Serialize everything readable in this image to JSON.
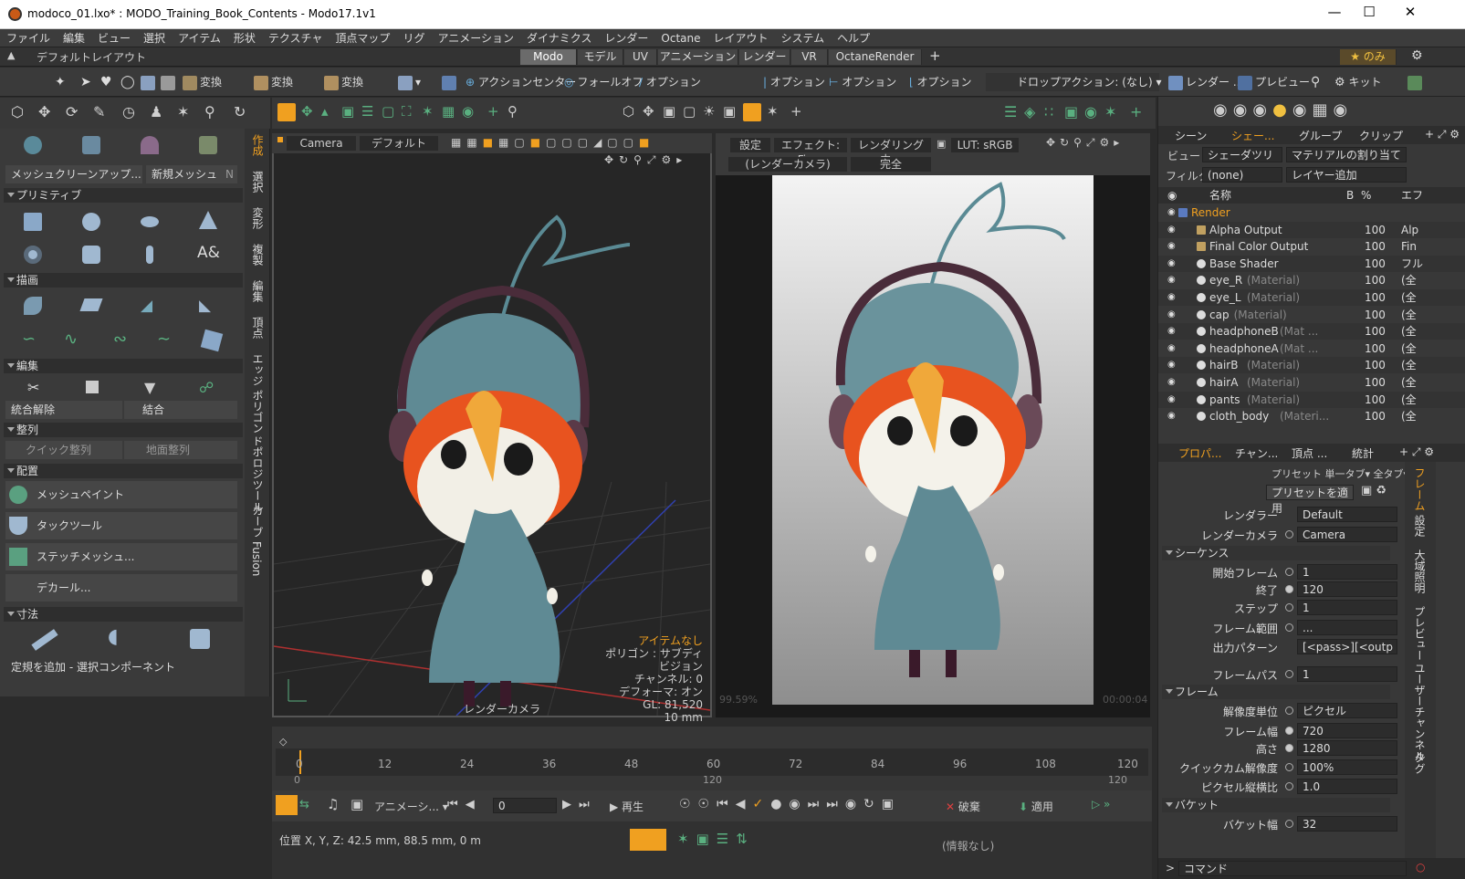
{
  "window": {
    "title": "modoco_01.lxo* : MODO_Training_Book_Contents - Modo17.1v1"
  },
  "menu": [
    "ファイル",
    "編集",
    "ビュー",
    "選択",
    "アイテム",
    "形状",
    "テクスチャ",
    "頂点マップ",
    "リグ",
    "アニメーション",
    "ダイナミクス",
    "レンダー",
    "Octane",
    "レイアウト",
    "システム",
    "ヘルプ"
  ],
  "layout": {
    "name": "デフォルトレイアウト",
    "tabs": [
      "Modo",
      "モデル",
      "UV",
      "アニメーション",
      "レンダー",
      "VR",
      "OctaneRender"
    ],
    "active": "Modo",
    "star_label": "★ のみ"
  },
  "toolbar1": {
    "transform1": "変換",
    "transform2": "変換",
    "transform3": "変換",
    "action_center": "アクションセンター",
    "falloff": "フォールオフ",
    "option1": "オプション",
    "option2": "オプション",
    "option3": "オプション",
    "option4": "オプション",
    "drop_action": "ドロップアクション: (なし)",
    "render": "レンダー ...",
    "preview": "プレビュー",
    "kit": "キット"
  },
  "left": {
    "mesh_cleanup": "メッシュクリーンアップ...",
    "new_mesh": "新規メッシュ",
    "new_mesh_key": "N",
    "primitive": "プリミティブ",
    "draw": "描画",
    "edit": "編集",
    "unmerge": "統合解除",
    "merge": "結合",
    "align": "整列",
    "quick_align": "クイック整列",
    "ground_align": "地面整列",
    "place": "配置",
    "mesh_paint": "メッシュペイント",
    "tack_tool": "タックツール",
    "stitch_mesh": "ステッチメッシュ...",
    "decal": "デカール...",
    "dimension": "寸法",
    "add_ruler": "定規を追加 - 選択コンポーネント"
  },
  "vtabs": [
    "作成",
    "選択",
    "変形",
    "複製",
    "編集",
    "頂点",
    "エッジ",
    "ポリゴン",
    "ドポロジツール",
    "カーブ",
    "Fusion"
  ],
  "vp1": {
    "camera": "Camera",
    "default": "デフォルト",
    "info_none": "アイテムなし",
    "info_polygon": "ポリゴン : サブディビジョン",
    "info_channel": "チャンネル: 0",
    "info_deformer": "デフォーマ: オン",
    "info_gl": "GL: 81,520",
    "info_size": "10 mm",
    "camera_label": "レンダーカメラ"
  },
  "vp2": {
    "settings": "設定",
    "effect": "エフェクト: Fin...",
    "rendering": "レンダリング中...",
    "lut": "LUT: sRGB",
    "render_cam": "(レンダーカメラ)",
    "complete": "完全",
    "percent": "99.59%",
    "time": "00:00:04"
  },
  "shader": {
    "tabs": [
      "シーン",
      "シェー...",
      "グループ",
      "クリップ"
    ],
    "view_label": "ビュー",
    "view_value": "シェーダツリー",
    "assign": "マテリアルの割り当て",
    "filter_label": "フィルター",
    "filter_value": "(none)",
    "add_layer": "レイヤー追加",
    "col_name": "名称",
    "col_b": "B",
    "col_pct": "%",
    "col_e": "エフ",
    "rows": [
      {
        "name": "Render",
        "type": "",
        "pct": "",
        "e": ""
      },
      {
        "name": "Alpha Output",
        "type": "",
        "pct": "100",
        "e": "Alp"
      },
      {
        "name": "Final Color Output",
        "type": "",
        "pct": "100",
        "e": "Fin"
      },
      {
        "name": "Base Shader",
        "type": "",
        "pct": "100",
        "e": "フル"
      },
      {
        "name": "eye_R",
        "type": "(Material)",
        "pct": "100",
        "e": "(全"
      },
      {
        "name": "eye_L",
        "type": "(Material)",
        "pct": "100",
        "e": "(全"
      },
      {
        "name": "cap",
        "type": "(Material)",
        "pct": "100",
        "e": "(全"
      },
      {
        "name": "headphoneB",
        "type": "(Mat ...",
        "pct": "100",
        "e": "(全"
      },
      {
        "name": "headphoneA",
        "type": "(Mat ...",
        "pct": "100",
        "e": "(全"
      },
      {
        "name": "hairB",
        "type": "(Material)",
        "pct": "100",
        "e": "(全"
      },
      {
        "name": "hairA",
        "type": "(Material)",
        "pct": "100",
        "e": "(全"
      },
      {
        "name": "pants",
        "type": "(Material)",
        "pct": "100",
        "e": "(全"
      },
      {
        "name": "cloth_body",
        "type": "(Materi...",
        "pct": "100",
        "e": "(全"
      }
    ]
  },
  "props": {
    "tabs": [
      "プロパ...",
      "チャン...",
      "頂点 ...",
      "統計"
    ],
    "preset": "プリセット",
    "single_tab": "単一タブ",
    "all_tab": "全タブ",
    "apply_preset": "プリセットを適用",
    "renderer_label": "レンダラー",
    "renderer_value": "Default",
    "render_cam_label": "レンダーカメラ",
    "render_cam_value": "Camera",
    "sequence": "シーケンス",
    "start_frame": "開始フレーム",
    "start_value": "1",
    "end_label": "終了",
    "end_value": "120",
    "step_label": "ステップ",
    "step_value": "1",
    "frame_range": "フレーム範囲",
    "frame_range_value": "...",
    "output_pattern": "出力パターン",
    "output_value": "[<pass>][<outp",
    "frame_pass": "フレームパス",
    "frame_pass_value": "1",
    "frame": "フレーム",
    "res_unit": "解像度単位",
    "res_unit_value": "ピクセル",
    "frame_width": "フレーム幅",
    "width_value": "720",
    "height_label": "高さ",
    "height_value": "1280",
    "quick_cam": "クイックカム解像度",
    "quick_cam_value": "100%",
    "pixel_aspect": "ピクセル縦横比",
    "pixel_aspect_value": "1.0",
    "bucket": "バケット",
    "bucket_width": "バケット幅",
    "bucket_value": "32",
    "side_tabs": [
      "フレーム",
      "設定",
      "大域照明",
      "プレビュー",
      "ユーザーチャンネル",
      "タグ"
    ]
  },
  "timeline": {
    "ticks": [
      "0",
      "12",
      "24",
      "36",
      "48",
      "60",
      "72",
      "84",
      "96",
      "108",
      "120"
    ],
    "sub_left": "0",
    "sub_mid": "120",
    "sub_right": "120"
  },
  "playbar": {
    "anim": "アニメーシ...",
    "frame": "0",
    "play": "再生",
    "discard": "破棄",
    "apply": "適用"
  },
  "status": {
    "position": "位置 X, Y, Z:  42.5 mm, 88.5 mm, 0 m",
    "info": "(情報なし)",
    "command": "コマンド"
  },
  "colors": {
    "accent": "#f0a020",
    "panel": "#3a3a3a"
  }
}
